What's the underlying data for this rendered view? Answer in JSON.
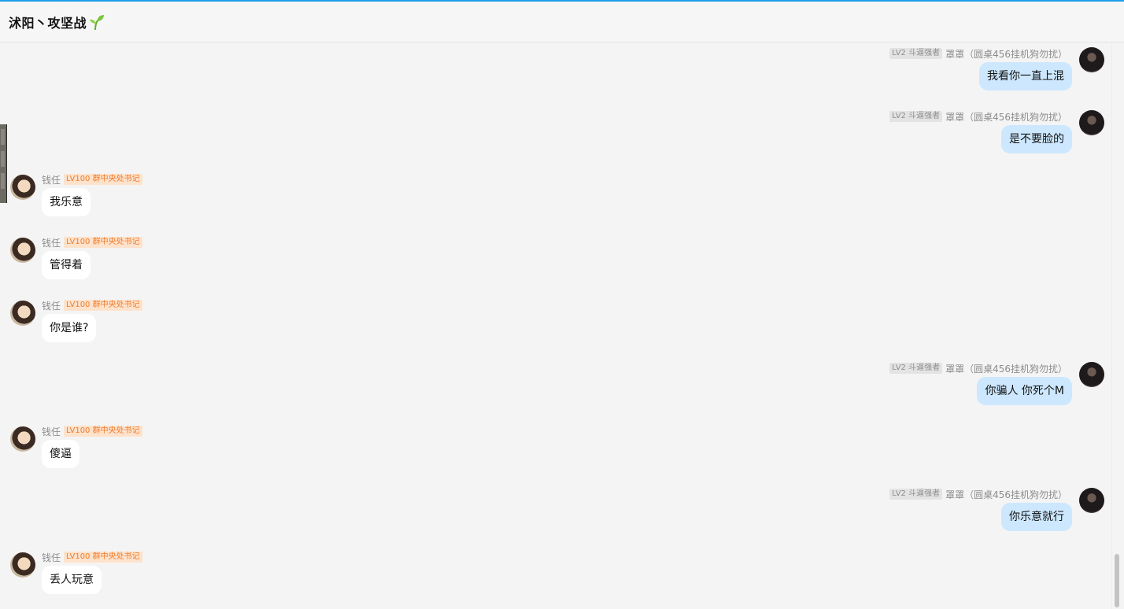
{
  "header": {
    "title": "沭阳丶攻坚战"
  },
  "users": {
    "left": {
      "name": "钱任",
      "badge": "LV100 群中央处书记"
    },
    "right": {
      "name": "罩罩（圆桌456挂机狗勿扰）",
      "badge": "LV2 斗逼强者"
    }
  },
  "messages": [
    {
      "side": "right",
      "name": "罩罩（圆桌456挂机狗勿扰）",
      "badge": "LV2 斗逼强者",
      "text": "我看你一直上混"
    },
    {
      "side": "right",
      "name": "罩罩（圆桌456挂机狗勿扰）",
      "badge": "LV2 斗逼强者",
      "text": "是不要脸的"
    },
    {
      "side": "left",
      "name": "钱任",
      "badge": "LV100 群中央处书记",
      "text": "我乐意"
    },
    {
      "side": "left",
      "name": "钱任",
      "badge": "LV100 群中央处书记",
      "text": "管得着"
    },
    {
      "side": "left",
      "name": "钱任",
      "badge": "LV100 群中央处书记",
      "text": "你是谁?"
    },
    {
      "side": "right",
      "name": "罩罩（圆桌456挂机狗勿扰）",
      "badge": "LV2 斗逼强者",
      "text": "你骗人 你死个M"
    },
    {
      "side": "left",
      "name": "钱任",
      "badge": "LV100 群中央处书记",
      "text": "傻逼"
    },
    {
      "side": "right",
      "name": "罩罩（圆桌456挂机狗勿扰）",
      "badge": "LV2 斗逼强者",
      "text": "你乐意就行"
    },
    {
      "side": "left",
      "name": "钱任",
      "badge": "LV100 群中央处书记",
      "text": "丢人玩意"
    }
  ],
  "colors": {
    "accent": "#1e9fe8",
    "self_bubble": "#cde8fe",
    "other_bubble": "#ffffff",
    "badge_orange_bg": "#fde2cc",
    "badge_orange_fg": "#f07d2c"
  },
  "icons": {
    "title_emoji": "sprout-icon"
  }
}
